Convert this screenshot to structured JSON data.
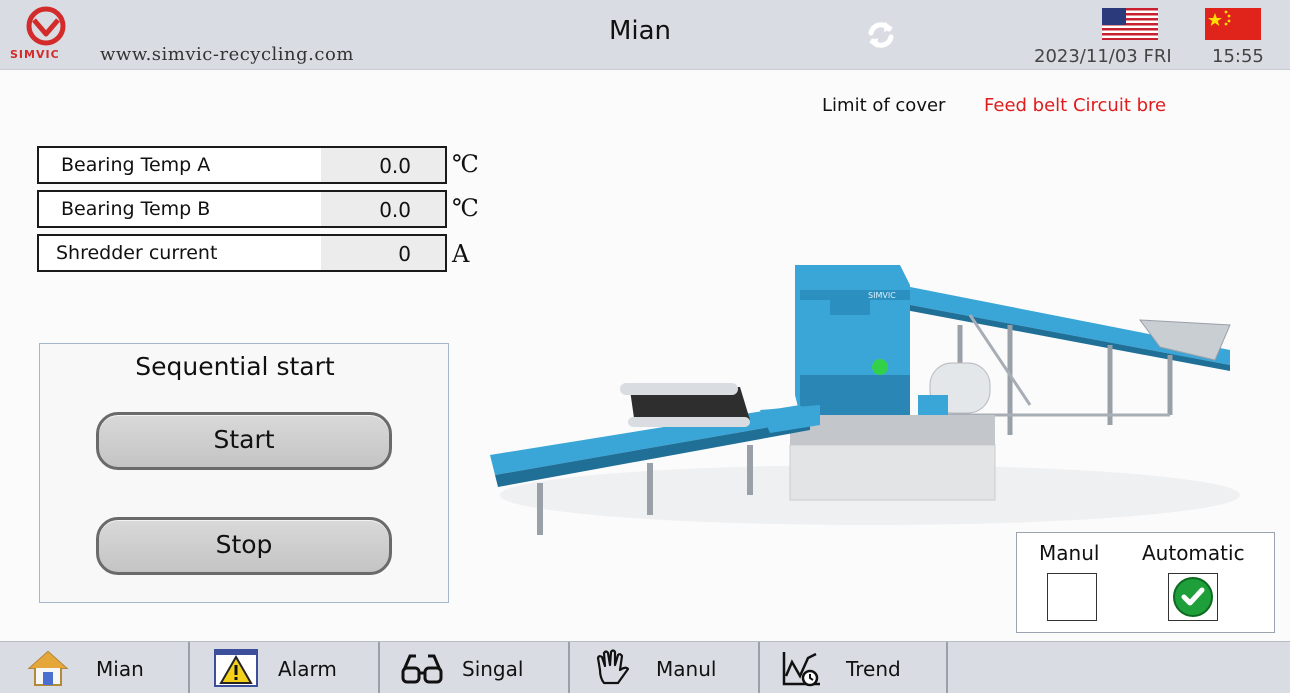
{
  "header": {
    "logo_text": "SIMVIC",
    "url": "www.simvic-recycling.com",
    "title": "Mian",
    "date": "2023/11/03 FRI",
    "time": "15:55"
  },
  "status": {
    "label": "Limit of cover",
    "alarm": "Feed belt Circuit bre"
  },
  "readings": [
    {
      "label": "Bearing Temp A",
      "value": "0.0",
      "unit": "℃"
    },
    {
      "label": "Bearing Temp B",
      "value": "0.0",
      "unit": "℃"
    },
    {
      "label": "Shredder current",
      "value": "0",
      "unit": "A"
    }
  ],
  "sequential": {
    "title": "Sequential start",
    "start_label": "Start",
    "stop_label": "Stop"
  },
  "mode": {
    "manual_label": "Manul",
    "automatic_label": "Automatic",
    "manual_checked": false,
    "automatic_checked": true
  },
  "nav": [
    {
      "label": "Mian",
      "icon": "home-icon"
    },
    {
      "label": "Alarm",
      "icon": "warning-icon"
    },
    {
      "label": "Singal",
      "icon": "glasses-icon"
    },
    {
      "label": "Manul",
      "icon": "hand-icon"
    },
    {
      "label": "Trend",
      "icon": "trend-icon"
    }
  ],
  "colors": {
    "header_bg": "#d9dde3",
    "alarm_text": "#e01b1b",
    "machine_blue": "#3aa6d8",
    "check_green": "#1e9f3a"
  }
}
